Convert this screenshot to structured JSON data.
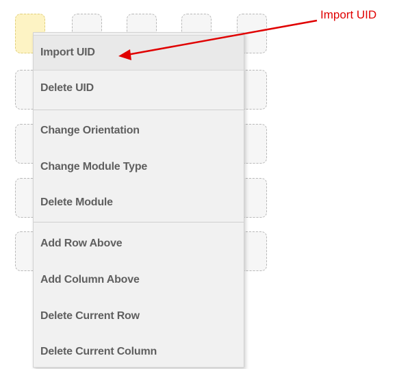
{
  "context_menu": {
    "items": [
      {
        "label": "Import UID"
      },
      {
        "label": "Delete UID"
      },
      {
        "label": "Change Orientation"
      },
      {
        "label": "Change Module Type"
      },
      {
        "label": "Delete Module"
      },
      {
        "label": "Add Row Above"
      },
      {
        "label": "Add Column Above"
      },
      {
        "label": "Delete Current Row"
      },
      {
        "label": "Delete Current Column"
      }
    ],
    "highlighted_item": "Import UID"
  },
  "annotation": {
    "text": "Import UID",
    "color": "#e00000"
  },
  "module_grid": {
    "selected_cell_color": "#fdf3c4",
    "cell_color": "#f6f6f6"
  }
}
